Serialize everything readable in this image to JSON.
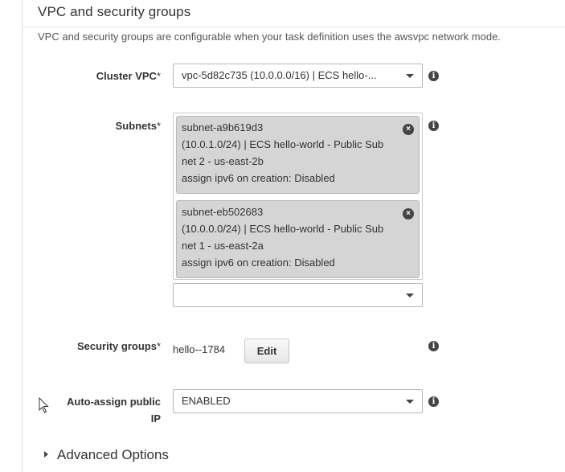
{
  "section": {
    "title": "VPC and security groups",
    "description": "VPC and security groups are configurable when your task definition uses the awsvpc network mode."
  },
  "cluster_vpc": {
    "label": "Cluster VPC",
    "required_mark": "*",
    "value": "vpc-5d82c735 (10.0.0.0/16) | ECS hello-..."
  },
  "subnets": {
    "label": "Subnets",
    "required_mark": "*",
    "selected": [
      {
        "id": "subnet-a9b619d3",
        "line2": "(10.0.1.0/24) | ECS hello-world - Public Sub",
        "line3": "net 2 - us-east-2b",
        "line4": "assign ipv6 on creation: Disabled"
      },
      {
        "id": "subnet-eb502683",
        "line2": "(10.0.0.0/24) | ECS hello-world - Public Sub",
        "line3": "net 1 - us-east-2a",
        "line4": "assign ipv6 on creation: Disabled"
      }
    ],
    "add_value": ""
  },
  "security_groups": {
    "label": "Security groups",
    "required_mark": "*",
    "value": "hello--1784",
    "edit_label": "Edit"
  },
  "auto_assign_ip": {
    "label_line1": "Auto-assign public",
    "label_line2": "IP",
    "value": "ENABLED"
  },
  "advanced": {
    "label": "Advanced Options"
  },
  "icons": {
    "info": "i",
    "remove": "×"
  }
}
